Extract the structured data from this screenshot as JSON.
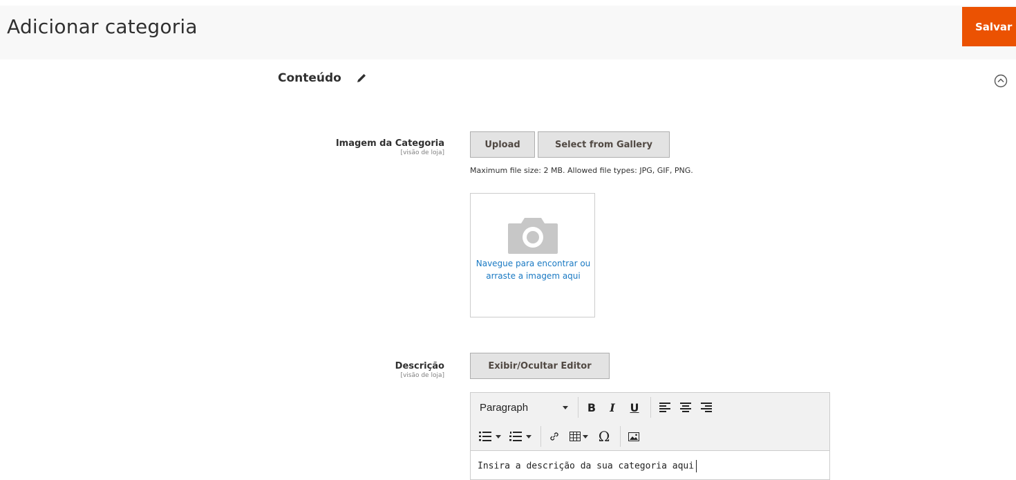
{
  "header": {
    "title": "Adicionar categoria",
    "save_label": "Salvar",
    "save_color": "#eb5202"
  },
  "section": {
    "title": "Conteúdo",
    "edit_icon": "pencil-icon",
    "collapse_icon": "chevron-up-circle-icon"
  },
  "image_field": {
    "label": "Imagem da Categoria",
    "scope": "[visão de loja]",
    "upload_label": "Upload",
    "gallery_label": "Select from Gallery",
    "file_note": "Maximum file size: 2 MB. Allowed file types: JPG, GIF, PNG.",
    "dropzone_text": "Navegue para encontrar ou arraste a imagem aqui",
    "dropzone_icon": "camera-icon",
    "link_color": "#1979c3"
  },
  "description_field": {
    "label": "Descrição",
    "scope": "[visão de loja]",
    "toggle_label": "Exibir/Ocultar Editor",
    "format_value": "Paragraph",
    "toolbar": {
      "bold": "B",
      "italic": "I",
      "underline": "U",
      "special_char": "Ω"
    },
    "content": "Insira a descrição da sua categoria aqui"
  }
}
